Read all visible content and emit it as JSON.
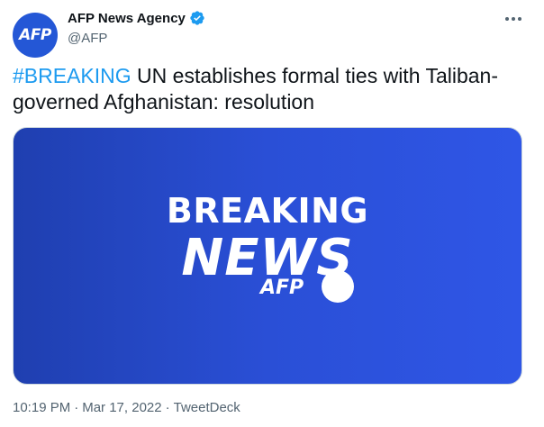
{
  "author": {
    "avatar_text": "AFP",
    "display_name": "AFP News Agency",
    "handle": "@AFP",
    "verified": true
  },
  "tweet": {
    "hashtag": "#BREAKING",
    "body": " UN establishes formal ties with Taliban-governed Afghanistan: resolution"
  },
  "media": {
    "line1": "BREAKING",
    "line2": "NEWS",
    "brand": "AFP"
  },
  "meta": {
    "time": "10:19 PM",
    "separator1": "·",
    "date": "Mar 17, 2022",
    "separator2": "·",
    "source": "TweetDeck"
  },
  "colors": {
    "link_blue": "#1d9bf0",
    "brand_blue": "#2457d6",
    "muted": "#536471"
  },
  "icons": {
    "verified": "verified-badge-icon",
    "more": "more-horizontal-icon"
  }
}
